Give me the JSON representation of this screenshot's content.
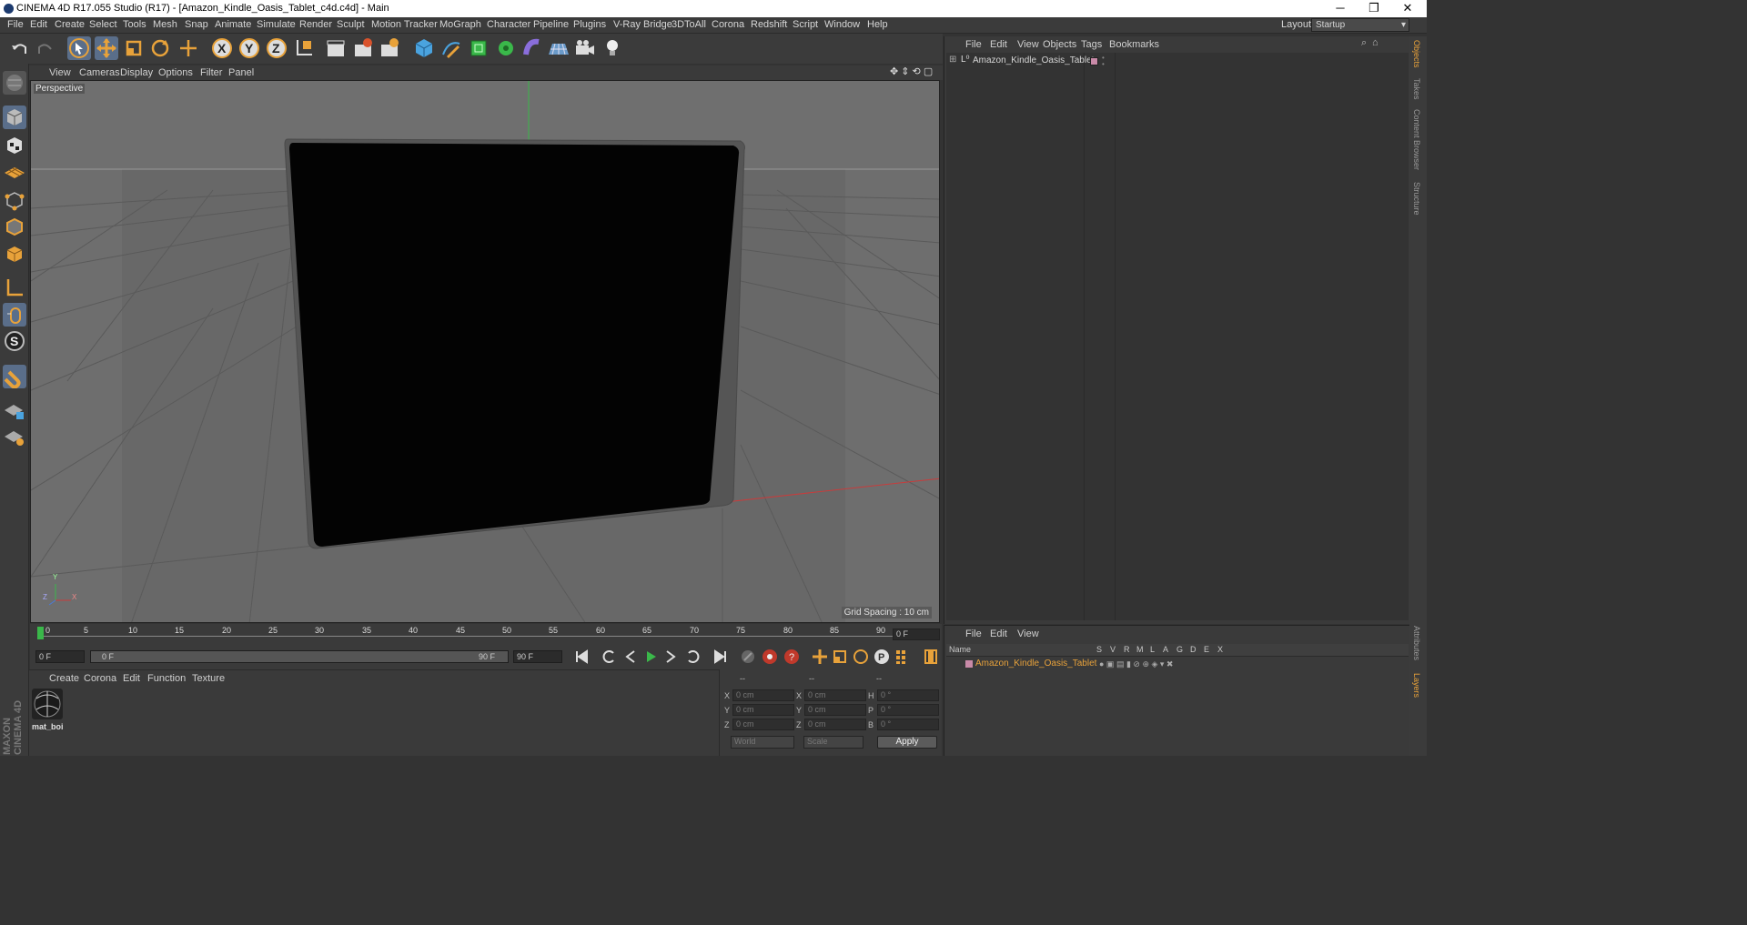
{
  "window": {
    "title": "CINEMA 4D R17.055 Studio (R17) - [Amazon_Kindle_Oasis_Tablet_c4d.c4d] - Main",
    "minimize": "─",
    "restore": "❐",
    "close": "✕"
  },
  "menubar": {
    "items": [
      "File",
      "Edit",
      "Create",
      "Select",
      "Tools",
      "Mesh",
      "Snap",
      "Animate",
      "Simulate",
      "Render",
      "Sculpt",
      "Motion Tracker",
      "MoGraph",
      "Character",
      "Pipeline",
      "Plugins",
      "V-Ray Bridge",
      "3DToAll",
      "Corona",
      "Redshift",
      "Script",
      "Window",
      "Help"
    ],
    "layout_label": "Layout:",
    "layout_value": "Startup"
  },
  "toolbar": {
    "axis_x": "X",
    "axis_y": "Y",
    "axis_z": "Z"
  },
  "viewport": {
    "menu": [
      "View",
      "Cameras",
      "Display",
      "Options",
      "Filter",
      "Panel"
    ],
    "label": "Perspective",
    "grid_spacing": "Grid Spacing : 10 cm",
    "axis_y": "Y",
    "axis_x": "X",
    "axis_z": "Z"
  },
  "timeline": {
    "ticks": [
      "0",
      "5",
      "10",
      "15",
      "20",
      "25",
      "30",
      "35",
      "40",
      "45",
      "50",
      "55",
      "60",
      "65",
      "70",
      "75",
      "80",
      "85",
      "90"
    ],
    "current_frame": "0 F"
  },
  "transport": {
    "start": "0 F",
    "range_start": "0 F",
    "range_end": "90 F",
    "end": "90 F"
  },
  "material_manager": {
    "menu": [
      "Create",
      "Corona",
      "Edit",
      "Function",
      "Texture"
    ],
    "material_name": "mat_boi"
  },
  "coordinates": {
    "headers": [
      "--",
      "--",
      "--"
    ],
    "labels_pos": [
      "X",
      "Y",
      "Z"
    ],
    "labels_size": [
      "X",
      "Y",
      "Z"
    ],
    "labels_rot": [
      "H",
      "P",
      "B"
    ],
    "pos": [
      "0 cm",
      "0 cm",
      "0 cm"
    ],
    "size": [
      "0 cm",
      "0 cm",
      "0 cm"
    ],
    "rot": [
      "0 °",
      "0 °",
      "0 °"
    ],
    "mode": "World",
    "scale": "Scale",
    "apply": "Apply"
  },
  "object_manager": {
    "menu": [
      "File",
      "Edit",
      "View",
      "Objects",
      "Tags",
      "Bookmarks"
    ],
    "object": "Amazon_Kindle_Oasis_Tablet"
  },
  "layer_manager": {
    "menu": [
      "File",
      "Edit",
      "View"
    ],
    "columns": [
      "Name",
      "S",
      "V",
      "R",
      "M",
      "L",
      "A",
      "G",
      "D",
      "E",
      "X"
    ],
    "layer": "Amazon_Kindle_Oasis_Tablet"
  },
  "right_tabs": [
    "Objects",
    "Takes",
    "Content Browser",
    "Structure",
    "Attributes",
    "Layers"
  ],
  "brand": "MAXON CINEMA 4D",
  "colors": {
    "accent": "#e8a23a",
    "selection": "#5a6e8a",
    "layer_color": "#c98aa8"
  }
}
